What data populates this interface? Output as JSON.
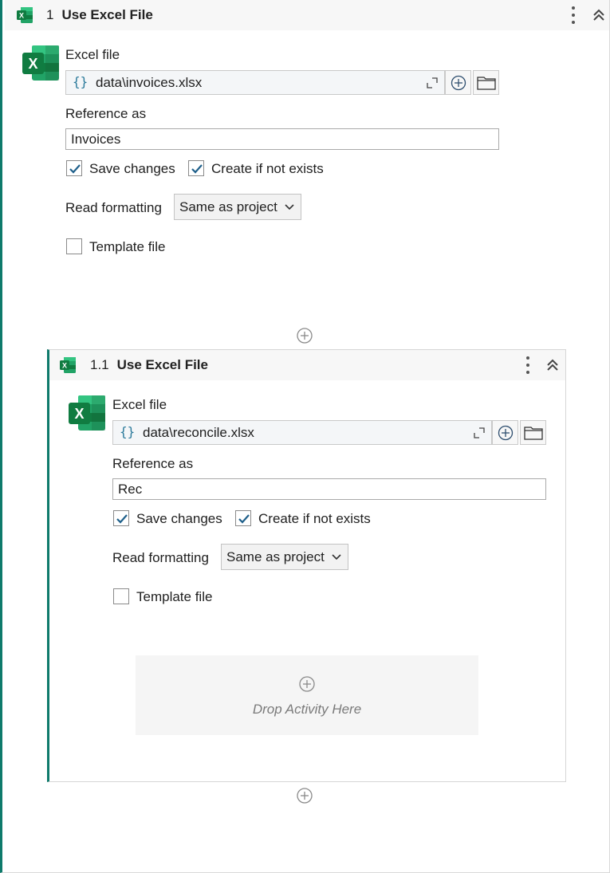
{
  "outer": {
    "number": "1",
    "title": "Use Excel File",
    "excel_file_label": "Excel file",
    "excel_file_value": "data\\invoices.xlsx",
    "reference_label": "Reference as",
    "reference_value": "Invoices",
    "save_changes_label": "Save changes",
    "save_changes_checked": true,
    "create_label": "Create if not exists",
    "create_checked": true,
    "read_formatting_label": "Read formatting",
    "read_formatting_value": "Same as project",
    "template_label": "Template file",
    "template_checked": false
  },
  "inner": {
    "number": "1.1",
    "title": "Use Excel File",
    "excel_file_label": "Excel file",
    "excel_file_value": "data\\reconcile.xlsx",
    "reference_label": "Reference as",
    "reference_value": "Rec",
    "save_changes_label": "Save changes",
    "save_changes_checked": true,
    "create_label": "Create if not exists",
    "create_checked": true,
    "read_formatting_label": "Read formatting",
    "read_formatting_value": "Same as project",
    "template_label": "Template file",
    "template_checked": false,
    "drop_text": "Drop Activity Here"
  },
  "icons": {
    "brace": "{}",
    "excel": "excel-icon",
    "kebab": "more-options-icon",
    "collapse": "collapse-icon",
    "expand": "expand-icon",
    "plus": "plus-circle-icon",
    "folder": "folder-icon"
  },
  "colors": {
    "accent": "#0e7a6b",
    "excel_green": "#107c41",
    "checkmark": "#1e5f8a"
  }
}
